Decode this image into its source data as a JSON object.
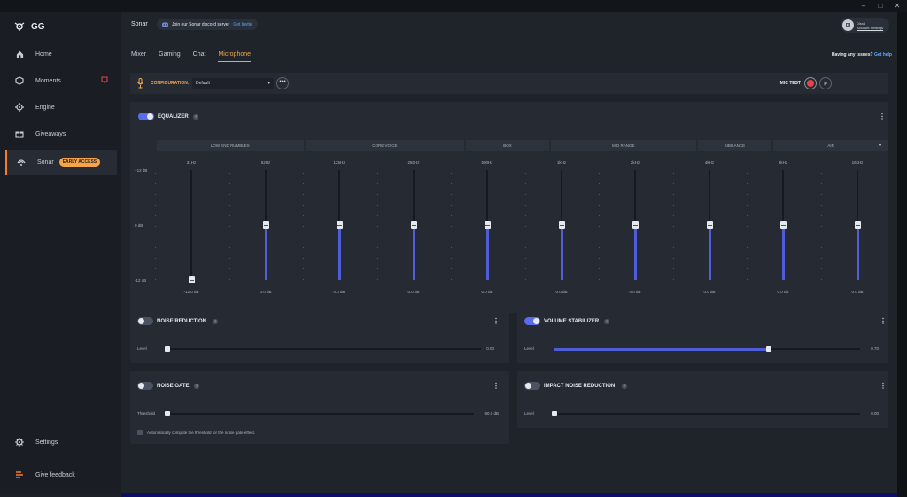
{
  "app": {
    "logo_text": "GG"
  },
  "window_controls": {
    "minimize": "–",
    "maximize": "□",
    "close": "✕"
  },
  "sidebar": {
    "items": [
      {
        "label": "Home",
        "icon": "home-icon"
      },
      {
        "label": "Moments",
        "icon": "hexagon-icon"
      },
      {
        "label": "Engine",
        "icon": "gear-icon"
      },
      {
        "label": "Giveaways",
        "icon": "gift-icon"
      },
      {
        "label": "Sonar",
        "icon": "sonar-icon",
        "badge": "EARLY ACCESS",
        "active": true
      }
    ],
    "settings_label": "Settings",
    "feedback_label": "Give feedback"
  },
  "header": {
    "title": "Sonar",
    "discord_text": "Join our Sonar discord server",
    "discord_link": "Get Invite",
    "account": {
      "avatar_initials": "DI",
      "name": "Dirzal",
      "link": "Account Settings"
    }
  },
  "tabs": [
    {
      "label": "Mixer"
    },
    {
      "label": "Gaming"
    },
    {
      "label": "Chat"
    },
    {
      "label": "Microphone",
      "active": true
    }
  ],
  "help": {
    "text": "Having any issues?",
    "link": "Get help"
  },
  "config": {
    "label": "CONFIGURATION:",
    "value": "Default",
    "more": "•••",
    "mic_test_label": "MIC TEST"
  },
  "equalizer": {
    "title": "EQUALIZER",
    "enabled": true,
    "help": "?",
    "bands": [
      "LOW END RUMBLES",
      "CORE VOICE",
      "BOX",
      "MID RANGE",
      "SIBILANCE",
      "AIR"
    ],
    "y_labels": [
      "+12 dB",
      "0 dB",
      "-12 dB"
    ],
    "frequencies": [
      "31Hz",
      "62Hz",
      "125Hz",
      "250Hz",
      "500Hz",
      "1kHz",
      "2kHz",
      "4kHz",
      "8kHz",
      "16kHz"
    ],
    "gains_db": [
      -12,
      0,
      0,
      0,
      0,
      0,
      0,
      0,
      0,
      0
    ],
    "gain_labels": [
      "-12.0 dB",
      "0.0 dB",
      "0.0 dB",
      "0.0 dB",
      "0.0 dB",
      "0.0 dB",
      "0.0 dB",
      "0.0 dB",
      "0.0 dB",
      "0.0 dB"
    ],
    "range_db": [
      -12,
      12
    ],
    "accent_color": "#5b6bf0"
  },
  "noise_reduction": {
    "title": "NOISE REDUCTION",
    "enabled": false,
    "help": "?",
    "slider_label": "Level",
    "value": "0.00",
    "fraction": 0.0
  },
  "volume_stabilizer": {
    "title": "VOLUME STABILIZER",
    "enabled": true,
    "help": "?",
    "slider_label": "Level",
    "value": "0.70",
    "fraction": 0.7
  },
  "noise_gate": {
    "title": "NOISE GATE",
    "enabled": false,
    "help": "?",
    "slider_label": "Threshold",
    "value": "-60.0 dB",
    "fraction": 0.0,
    "checkbox_label": "Automatically compute the threshold for the noise gate effect."
  },
  "impact_noise_reduction": {
    "title": "IMPACT NOISE REDUCTION",
    "enabled": false,
    "help": "?",
    "slider_label": "Level",
    "value": "0.00",
    "fraction": 0.0
  },
  "colors": {
    "accent_orange": "#f5a44a",
    "accent_blue": "#5b6bf0",
    "record_red": "#e8434b"
  }
}
